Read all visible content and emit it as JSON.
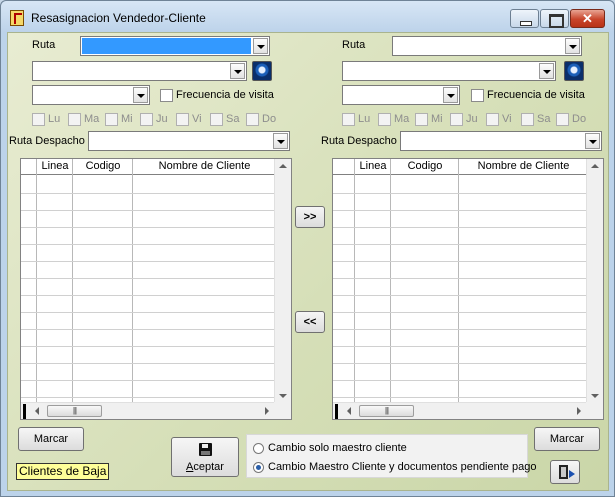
{
  "window": {
    "title": "Resasignacion  Vendedor-Cliente"
  },
  "left": {
    "ruta_label": "Ruta",
    "frecuencia_label": "Frecuencia de visita",
    "days": [
      "Lu",
      "Ma",
      "Mi",
      "Ju",
      "Vi",
      "Sa",
      "Do"
    ],
    "despacho_label": "Ruta Despacho",
    "columns": [
      "Linea",
      "Codigo",
      "Nombre de Cliente"
    ],
    "marcar_label": "Marcar"
  },
  "right": {
    "ruta_label": "Ruta",
    "frecuencia_label": "Frecuencia de visita",
    "days": [
      "Lu",
      "Ma",
      "Mi",
      "Ju",
      "Vi",
      "Sa",
      "Do"
    ],
    "despacho_label": "Ruta Despacho",
    "columns": [
      "Linea",
      "Codigo",
      "Nombre de Cliente"
    ],
    "marcar_label": "Marcar"
  },
  "transfer": {
    "to_right": ">>",
    "to_left": "<<"
  },
  "aceptar": {
    "label_underline": "A",
    "label_rest": "ceptar"
  },
  "options": {
    "items": [
      "Cambio solo maestro cliente",
      "Cambio Maestro Cliente y documentos pendiente pago"
    ],
    "selected": 1
  },
  "clientes_baja_label": "Clientes de Baja",
  "colors": {
    "selection": "#3399ff",
    "badge": "#ffff99"
  }
}
